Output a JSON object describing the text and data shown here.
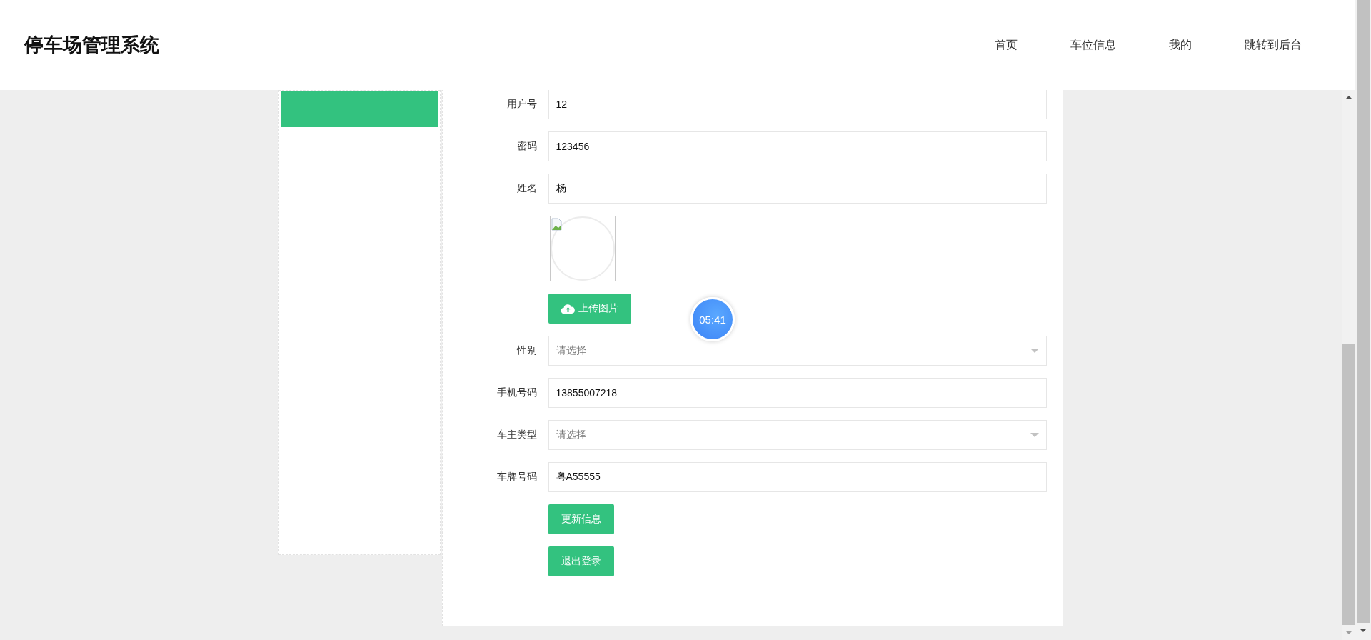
{
  "header": {
    "title": "停车场管理系统",
    "nav": [
      {
        "label": "首页"
      },
      {
        "label": "车位信息"
      },
      {
        "label": "我的"
      },
      {
        "label": "跳转到后台"
      }
    ]
  },
  "form": {
    "fields": [
      {
        "kind": "text",
        "label": "用户号",
        "value": "12"
      },
      {
        "kind": "text",
        "label": "密码",
        "value": "123456"
      },
      {
        "kind": "text",
        "label": "姓名",
        "value": "杨"
      },
      {
        "kind": "avatar"
      },
      {
        "kind": "upload",
        "button": "上传图片"
      },
      {
        "kind": "select",
        "label": "性别",
        "placeholder": "请选择"
      },
      {
        "kind": "text",
        "label": "手机号码",
        "value": "13855007218"
      },
      {
        "kind": "select",
        "label": "车主类型",
        "placeholder": "请选择"
      },
      {
        "kind": "text",
        "label": "车牌号码",
        "value": "粤A55555"
      }
    ],
    "buttons": [
      "更新信息",
      "退出登录"
    ]
  },
  "timer": {
    "text": "05:41"
  }
}
